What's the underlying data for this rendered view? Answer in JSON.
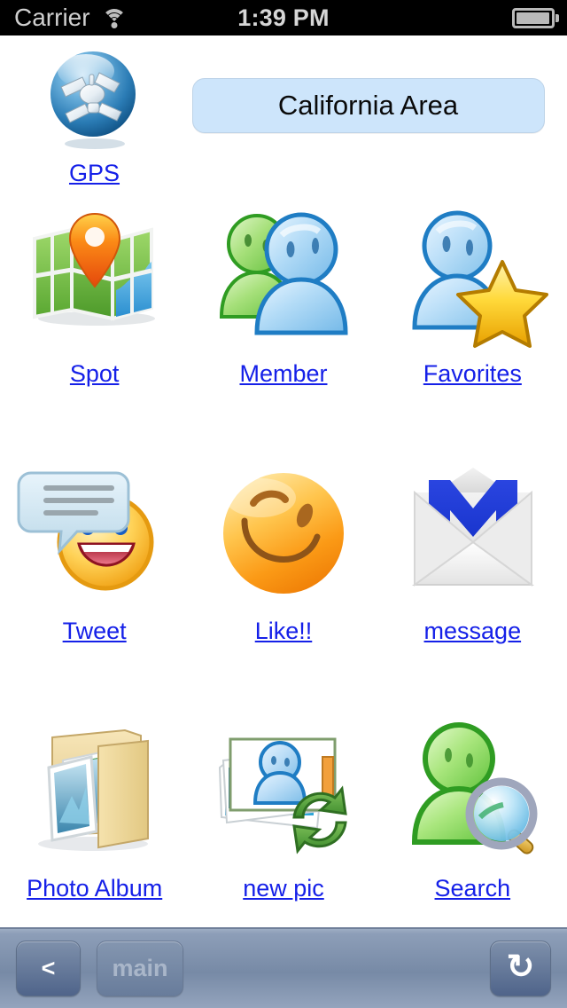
{
  "statusbar": {
    "carrier": "Carrier",
    "wifi_icon": "wifi-icon",
    "time": "1:39 PM",
    "battery_icon": "battery-icon"
  },
  "header": {
    "gps": {
      "label": "GPS",
      "icon": "gps-satellite-icon"
    },
    "banner": {
      "text": "California Area"
    }
  },
  "grid": {
    "items": [
      {
        "label": "Spot",
        "icon": "map-pin-icon"
      },
      {
        "label": "Member",
        "icon": "two-buddies-icon"
      },
      {
        "label": "Favorites",
        "icon": "buddy-star-icon"
      },
      {
        "label": "Tweet",
        "icon": "laughing-smiley-speech-bubble-icon"
      },
      {
        "label": "Like!!",
        "icon": "winking-smiley-icon"
      },
      {
        "label": "message",
        "icon": "gmail-envelope-icon"
      },
      {
        "label": "Photo Album",
        "icon": "photo-folder-icon"
      },
      {
        "label": "new pic",
        "icon": "photos-sync-icon"
      },
      {
        "label": "Search",
        "icon": "buddy-magnifier-icon"
      }
    ]
  },
  "toolbar": {
    "back_label": "<",
    "main_label": "main",
    "refresh_label": "↻"
  },
  "colors": {
    "link": "#1520E8",
    "banner_bg": "#CDE5FB",
    "toolbar_bg": "#778AA6",
    "status_bg": "#000000"
  }
}
